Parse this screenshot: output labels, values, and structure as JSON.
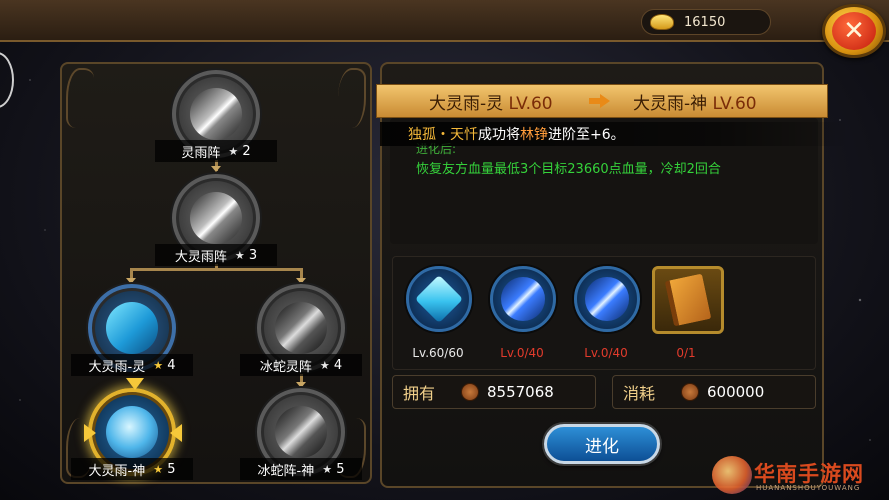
{
  "currency": {
    "icon": "gold-ingot-icon",
    "amount": "16150"
  },
  "close": {
    "icon": "close-icon",
    "glyph": "✕"
  },
  "tree": {
    "nodes": [
      {
        "name": "灵雨阵",
        "stars": "2"
      },
      {
        "name": "大灵雨阵",
        "stars": "3"
      },
      {
        "name": "大灵雨-灵",
        "stars": "4"
      },
      {
        "name": "冰蛇灵阵",
        "stars": "4"
      },
      {
        "name": "大灵雨-神",
        "stars": "5"
      },
      {
        "name": "冰蛇阵-神",
        "stars": "5"
      }
    ],
    "star_glyph": "★"
  },
  "upgrade": {
    "from_name": "大灵雨-灵",
    "from_lv": "LV.60",
    "to_name": "大灵雨-神",
    "to_lv": "LV.60"
  },
  "notice": {
    "player": "独孤・天忏",
    "text1": "成功将",
    "item": "林铮",
    "text2": "进阶至+6。"
  },
  "description": {
    "head": "进化后:",
    "text": "恢复友方血量最低3个目标23660点血量，冷却2回合"
  },
  "materials": [
    {
      "icon": "crystal-gem-icon",
      "count": "Lv.60/60"
    },
    {
      "icon": "blue-skill-orb-icon",
      "count": "Lv.0/40"
    },
    {
      "icon": "blue-skill-orb-icon",
      "count": "Lv.0/40"
    },
    {
      "icon": "golden-book-icon",
      "count": "0/1"
    }
  ],
  "owned": {
    "label": "拥有",
    "icon": "copper-coin-icon",
    "value": "8557068"
  },
  "cost": {
    "label": "消耗",
    "icon": "copper-coin-icon",
    "value": "600000"
  },
  "evolve_button": "进化",
  "watermark": {
    "title": "华南手游网",
    "subtitle": "HUANANSHOUYOUWANG"
  },
  "colors": {
    "accent_gold": "#f2c56e",
    "green_text": "#35d23b",
    "red_text": "#e23b2c",
    "button_blue": "#2d8fd7"
  }
}
